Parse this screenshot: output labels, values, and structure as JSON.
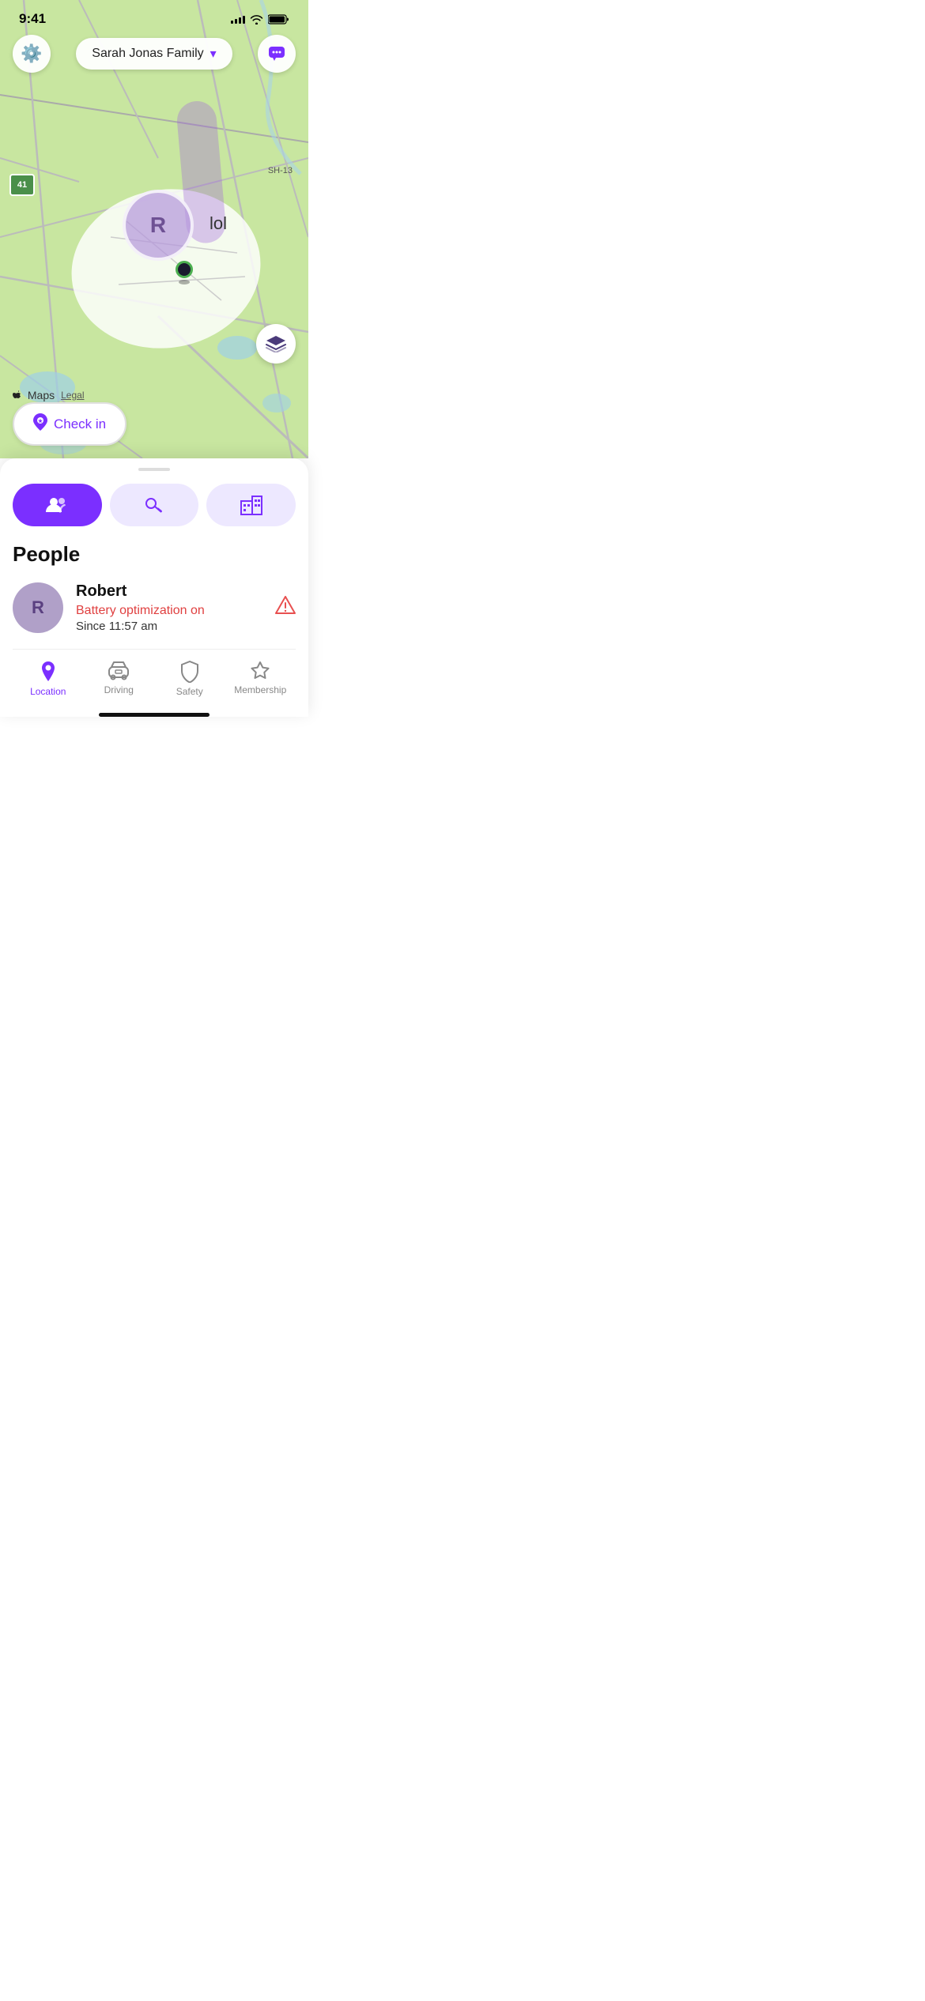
{
  "statusBar": {
    "time": "9:41",
    "signalBars": [
      4,
      6,
      8,
      10,
      12
    ],
    "wifi": "wifi",
    "battery": "battery"
  },
  "header": {
    "settingsIcon": "gear",
    "familyName": "Sarah Jonas Family",
    "chevron": "chevron-down",
    "messagesIcon": "message-bubble"
  },
  "map": {
    "roadSign41": "41",
    "roadSignSH": "SH-13",
    "cityLabel": "lol",
    "userInitial": "R",
    "layersIcon": "layers",
    "attribution": "Maps",
    "legalLabel": "Legal",
    "checkinLabel": "Check in"
  },
  "bottomSheet": {
    "handle": "",
    "tabs": [
      {
        "id": "people",
        "icon": "👥",
        "active": true
      },
      {
        "id": "keys",
        "icon": "🔑",
        "active": false
      },
      {
        "id": "buildings",
        "icon": "🏢",
        "active": false
      }
    ],
    "sectionTitle": "People",
    "members": [
      {
        "initial": "R",
        "name": "Robert",
        "status": "Battery optimization on",
        "since": "Since 11:57 am",
        "hasWarning": true
      }
    ]
  },
  "bottomNav": {
    "items": [
      {
        "id": "location",
        "label": "Location",
        "icon": "📍",
        "active": true
      },
      {
        "id": "driving",
        "label": "Driving",
        "icon": "🚗",
        "active": false
      },
      {
        "id": "safety",
        "label": "Safety",
        "icon": "🛡️",
        "active": false
      },
      {
        "id": "membership",
        "label": "Membership",
        "icon": "⭐",
        "active": false
      }
    ]
  },
  "colors": {
    "purple": "#7b2fff",
    "lightPurple": "#ede8ff",
    "mapGreen": "#c8e6a0",
    "urban": "#f0f0ec",
    "warning": "#e85050"
  }
}
